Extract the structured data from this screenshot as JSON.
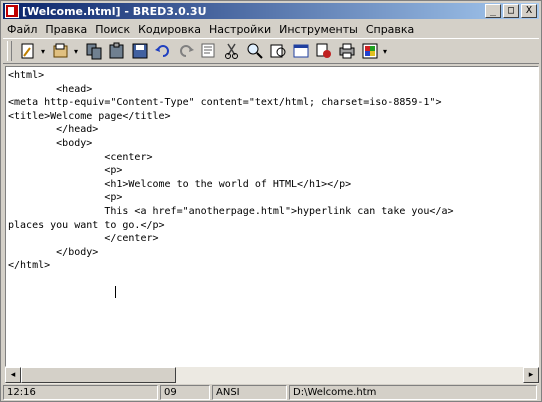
{
  "window": {
    "title": "[Welcome.html] - BRED3.0.3U",
    "minimize": "_",
    "maximize": "□",
    "close": "X"
  },
  "menu": [
    {
      "label": "Файл"
    },
    {
      "label": "Правка"
    },
    {
      "label": "Поиск"
    },
    {
      "label": "Кодировка"
    },
    {
      "label": "Настройки"
    },
    {
      "label": "Инструменты"
    },
    {
      "label": "Справка"
    }
  ],
  "toolbar": {
    "icons": [
      "new-icon",
      "open-icon",
      "copy-icon",
      "paste-icon",
      "save-icon",
      "undo-icon",
      "redo-icon",
      "find-icon",
      "cut-icon",
      "zoom-icon",
      "replace-icon",
      "window-icon",
      "tools-icon",
      "print-icon",
      "palette-icon"
    ]
  },
  "editor": {
    "lines": [
      "<html>",
      "        <head>",
      "<meta http-equiv=\"Content-Type\" content=\"text/html; charset=iso-8859-1\">",
      "<title>Welcome page</title>",
      "        </head>",
      "        <body>",
      "                <center>",
      "                <p>",
      "                <h1>Welcome to the world of HTML</h1></p>",
      "                <p>",
      "                This <a href=\"anotherpage.html\">hyperlink can take you</a>",
      "places you want to go.</p>",
      "                </center>",
      "        </body>",
      "</html>"
    ]
  },
  "statusbar": {
    "position": "12:16",
    "column": "09",
    "encoding": "ANSI",
    "path": "D:\\Welcome.htm"
  }
}
